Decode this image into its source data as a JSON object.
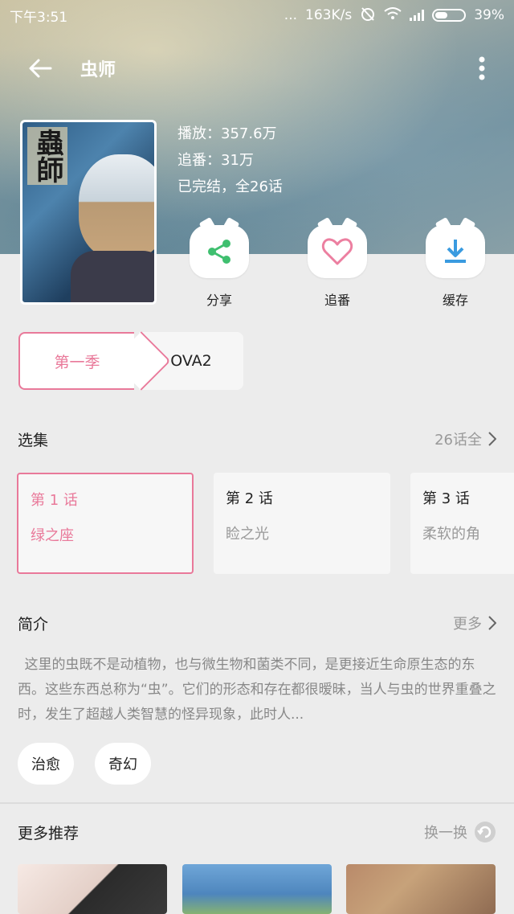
{
  "status_bar": {
    "time": "下午3:51",
    "dots": "...",
    "speed": "163K/s",
    "battery": "39%"
  },
  "app_bar": {
    "title": "虫师"
  },
  "meta": {
    "plays": "播放：357.6万",
    "follows": "追番：31万",
    "status": "已完结，全26话"
  },
  "actions": [
    {
      "label": "分享",
      "icon": "share-icon",
      "color": "#3fbf6f"
    },
    {
      "label": "追番",
      "icon": "heart-icon",
      "color": "#ec7fa0"
    },
    {
      "label": "缓存",
      "icon": "download-icon",
      "color": "#3a9be0"
    }
  ],
  "seasons": [
    {
      "label": "第一季",
      "selected": true
    },
    {
      "label": "OVA2",
      "selected": false
    }
  ],
  "episodes_section": {
    "title": "选集",
    "link": "26话全"
  },
  "episodes": [
    {
      "num": "第 1 话",
      "name": "绿之座",
      "active": true
    },
    {
      "num": "第 2 话",
      "name": "睑之光",
      "active": false
    },
    {
      "num": "第 3 话",
      "name": "柔软的角",
      "active": false
    }
  ],
  "intro_section": {
    "title": "简介",
    "link": "更多",
    "text": "这里的虫既不是动植物，也与微生物和菌类不同，是更接近生命原生态的东西。这些东西总称为“虫”。它们的形态和存在都很暧昧，当人与虫的世界重叠之时，发生了超越人类智慧的怪异现象，此时人..."
  },
  "tags": [
    "治愈",
    "奇幻"
  ],
  "recommend_section": {
    "title": "更多推荐",
    "link": "换一换"
  },
  "colors": {
    "accent_pink": "#e9799a",
    "muted_text": "#999999"
  }
}
